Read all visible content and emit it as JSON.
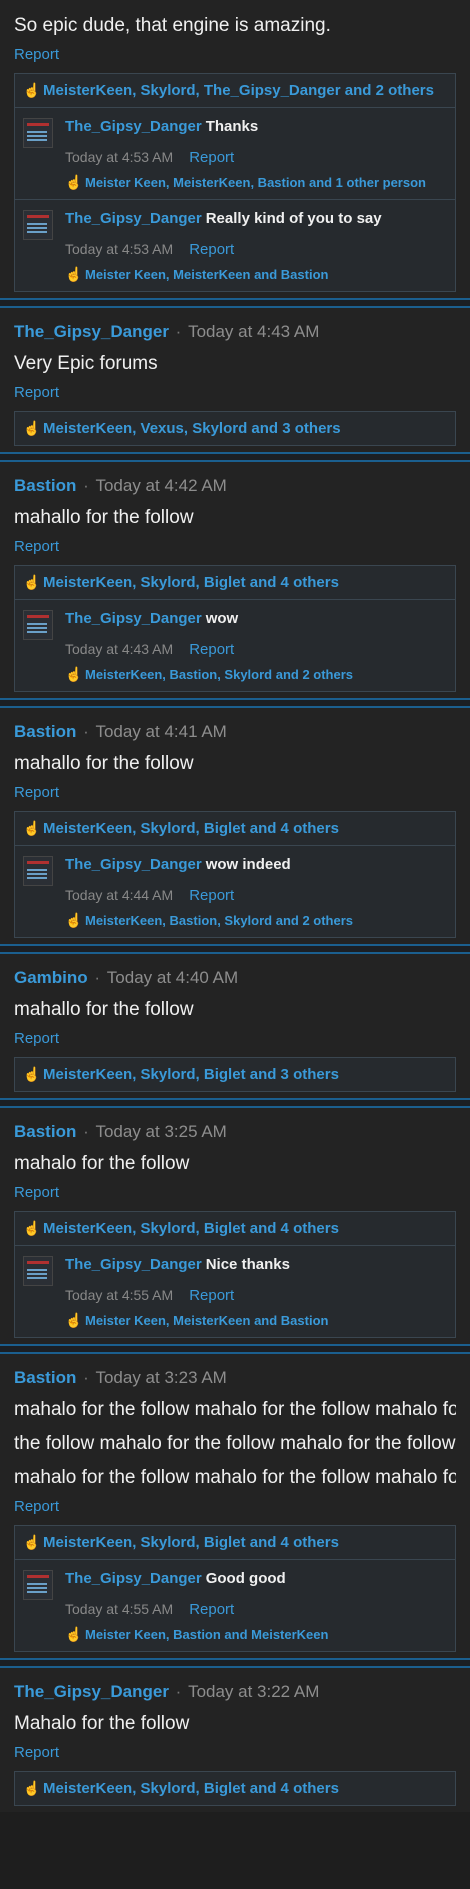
{
  "posts": [
    {
      "continuation": true,
      "author": "",
      "time": "",
      "body": [
        "So epic dude, that engine is amazing."
      ],
      "report": "Report",
      "likes": "MeisterKeen, Skylord, The_Gipsy_Danger and 2 others",
      "comments": [
        {
          "author": "The_Gipsy_Danger",
          "text": "Thanks",
          "time": "Today at 4:53 AM",
          "report": "Report",
          "likes": "Meister Keen, MeisterKeen, Bastion and 1 other person"
        },
        {
          "author": "The_Gipsy_Danger",
          "text": "Really kind of you to say",
          "time": "Today at 4:53 AM",
          "report": "Report",
          "likes": "Meister Keen, MeisterKeen and Bastion"
        }
      ]
    },
    {
      "author": "The_Gipsy_Danger",
      "time": "Today at 4:43 AM",
      "body": [
        "Very Epic forums"
      ],
      "report": "Report",
      "likes": "MeisterKeen, Vexus, Skylord and 3 others",
      "comments": []
    },
    {
      "author": "Bastion",
      "time": "Today at 4:42 AM",
      "body": [
        "mahallo for the follow"
      ],
      "report": "Report",
      "likes": "MeisterKeen, Skylord, Biglet and 4 others",
      "comments": [
        {
          "author": "The_Gipsy_Danger",
          "text": "wow",
          "time": "Today at 4:43 AM",
          "report": "Report",
          "likes": "MeisterKeen, Bastion, Skylord and 2 others"
        }
      ]
    },
    {
      "author": "Bastion",
      "time": "Today at 4:41 AM",
      "body": [
        "mahallo for the follow"
      ],
      "report": "Report",
      "likes": "MeisterKeen, Skylord, Biglet and 4 others",
      "comments": [
        {
          "author": "The_Gipsy_Danger",
          "text": "wow indeed",
          "time": "Today at 4:44 AM",
          "report": "Report",
          "likes": "MeisterKeen, Bastion, Skylord and 2 others"
        }
      ]
    },
    {
      "author": "Gambino",
      "time": "Today at 4:40 AM",
      "body": [
        "mahallo for the follow"
      ],
      "report": "Report",
      "likes": "MeisterKeen, Skylord, Biglet and 3 others",
      "comments": []
    },
    {
      "author": "Bastion",
      "time": "Today at 3:25 AM",
      "body": [
        "mahalo for the follow"
      ],
      "report": "Report",
      "likes": "MeisterKeen, Skylord, Biglet and 4 others",
      "comments": [
        {
          "author": "The_Gipsy_Danger",
          "text": "Nice thanks",
          "time": "Today at 4:55 AM",
          "report": "Report",
          "likes": "Meister Keen, MeisterKeen and Bastion"
        }
      ]
    },
    {
      "author": "Bastion",
      "time": "Today at 3:23 AM",
      "body": [
        "mahalo for the follow mahalo for the follow mahalo for the",
        "the follow mahalo for the follow mahalo for the follow mah",
        "mahalo for the follow mahalo for the follow mahalo for the"
      ],
      "report": "Report",
      "likes": "MeisterKeen, Skylord, Biglet and 4 others",
      "comments": [
        {
          "author": "The_Gipsy_Danger",
          "text": "Good good",
          "time": "Today at 4:55 AM",
          "report": "Report",
          "likes": "Meister Keen, Bastion and MeisterKeen"
        }
      ]
    },
    {
      "author": "The_Gipsy_Danger",
      "time": "Today at 3:22 AM",
      "body": [
        "Mahalo for the follow"
      ],
      "report": "Report",
      "likes": "MeisterKeen, Skylord, Biglet and 4 others",
      "comments": []
    }
  ],
  "icons": {
    "like": "thumbs-up-icon"
  },
  "colors": {
    "accent": "#3a9ad9",
    "background": "#232323",
    "separator": "#1b5f8f"
  }
}
